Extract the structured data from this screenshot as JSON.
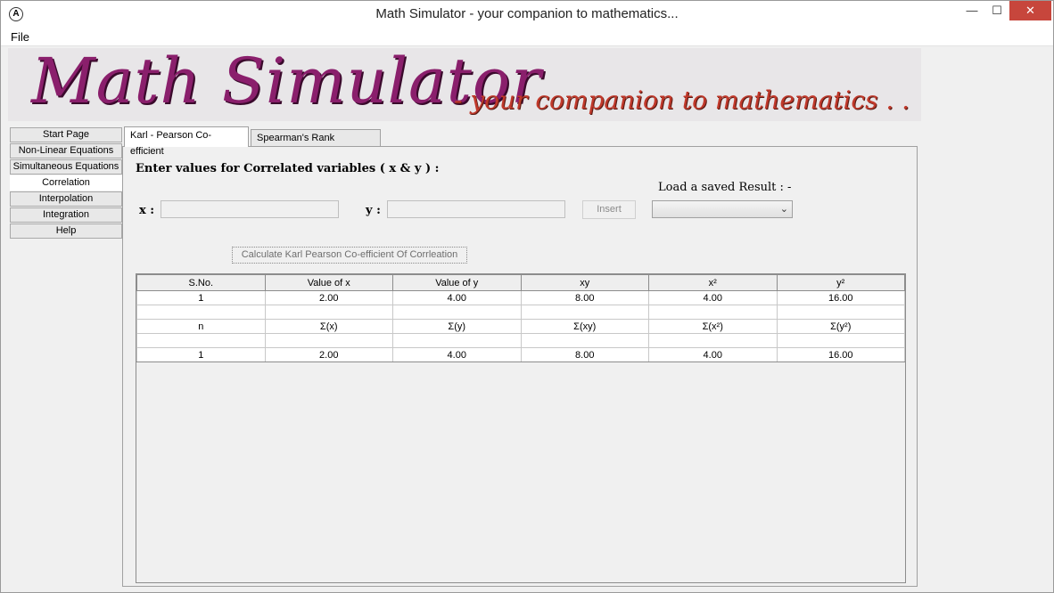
{
  "window": {
    "title": "Math Simulator - your companion to mathematics...",
    "minimize_glyph": "—",
    "maximize_glyph": "☐",
    "close_glyph": "✕"
  },
  "menu": {
    "file": "File"
  },
  "banner": {
    "title": "Math Simulator",
    "subtitle": "- your companion to mathematics . . ."
  },
  "sidebar": {
    "items": [
      {
        "label": "Start Page"
      },
      {
        "label": "Non-Linear Equations"
      },
      {
        "label": "Simultaneous Equations"
      },
      {
        "label": "Correlation"
      },
      {
        "label": "Interpolation"
      },
      {
        "label": "Integration"
      },
      {
        "label": "Help"
      }
    ],
    "active": "Correlation"
  },
  "tabs": [
    {
      "label": "Karl - Pearson Co-efficient"
    },
    {
      "label": "Spearman's Rank Correlation"
    }
  ],
  "form": {
    "heading": "Enter values for Correlated variables ( x & y ) :",
    "load_label": "Load a saved Result : -",
    "x_label": "x :",
    "y_label": "y :",
    "x_value": "",
    "y_value": "",
    "insert_label": "Insert",
    "select_value": "",
    "calculate_label": "Calculate Karl Pearson Co-efficient Of Corrleation"
  },
  "table": {
    "headers": [
      "S.No.",
      "Value of x",
      "Value of y",
      "xy",
      "x²",
      "y²"
    ],
    "rows": [
      [
        "1",
        "2.00",
        "4.00",
        "8.00",
        "4.00",
        "16.00"
      ],
      [
        "",
        "",
        "",
        "",
        "",
        ""
      ],
      [
        "n",
        "Σ(x)",
        "Σ(y)",
        "Σ(xy)",
        "Σ(x²)",
        "Σ(y²)"
      ],
      [
        "",
        "",
        "",
        "",
        "",
        ""
      ],
      [
        "1",
        "2.00",
        "4.00",
        "8.00",
        "4.00",
        "16.00"
      ]
    ]
  }
}
